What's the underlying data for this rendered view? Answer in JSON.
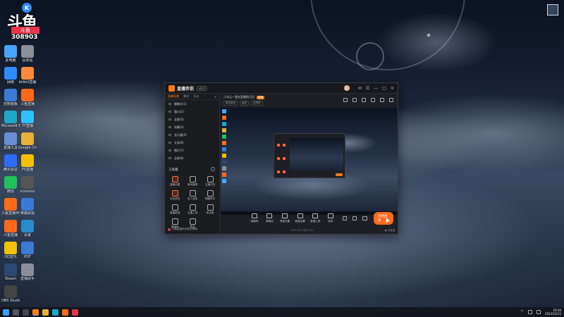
{
  "badge": {
    "k_letter": "K",
    "logo": "斗鱼",
    "tag": "斗鱼",
    "room_number": "308903"
  },
  "desktop_icons": [
    {
      "label": "此电脑",
      "color": "#4aa3ff"
    },
    {
      "label": "回收站",
      "color": "#8a8f9a"
    },
    {
      "label": "网络",
      "color": "#2f8cff"
    },
    {
      "label": "bilibili直播",
      "color": "#ff8a3a"
    },
    {
      "label": "控制面板",
      "color": "#3a7bd5"
    },
    {
      "label": "斗鱼直播",
      "color": "#ff6a1a"
    },
    {
      "label": "Microsoft Edge",
      "color": "#1fa7c9"
    },
    {
      "label": "YY直播",
      "color": "#2fc0ff"
    },
    {
      "label": "直播工具",
      "color": "#6b8fd6"
    },
    {
      "label": "Google Chrome",
      "color": "#e8b13a"
    },
    {
      "label": "腾讯会议",
      "color": "#2f6bff"
    },
    {
      "label": "PS直播",
      "color": "#f2c100"
    },
    {
      "label": "微信",
      "color": "#22c05a"
    },
    {
      "label": "ncsurion",
      "color": "#555"
    },
    {
      "label": "斗鱼直播伴侣",
      "color": "#ff6a1a"
    },
    {
      "label": "英雄联盟",
      "color": "#3a7bd5"
    },
    {
      "label": "斗鱼直播",
      "color": "#ff6a1a"
    },
    {
      "label": "设置",
      "color": "#2a8ac9"
    },
    {
      "label": "QQ音乐",
      "color": "#f2c100"
    },
    {
      "label": "PDF",
      "color": "#3a7bd5"
    },
    {
      "label": "Steam",
      "color": "#2a4a73"
    },
    {
      "label": "直播助手",
      "color": "#8a8f9a"
    },
    {
      "label": "OBS Studio",
      "color": "#444"
    }
  ],
  "app": {
    "title": "直播伴侣",
    "version": "v6.3",
    "left_tabs": [
      "直播场景",
      "素材",
      "互动"
    ],
    "scenes": [
      {
        "name": "摄像头(1)"
      },
      {
        "name": "窗口(2)"
      },
      {
        "name": "全屏(3)"
      },
      {
        "name": "场景(4)"
      },
      {
        "name": "显示器(5)"
      },
      {
        "name": "文本(6)"
      },
      {
        "name": "图片(7)"
      },
      {
        "name": "全屏(8)"
      }
    ],
    "toolbox_title": "工具箱",
    "tools": [
      {
        "label": "直播设置",
        "orange": true
      },
      {
        "label": "房间管理",
        "orange": false
      },
      {
        "label": "主播任务",
        "orange": false
      },
      {
        "label": "互动游戏",
        "orange": true
      },
      {
        "label": "多人连麦",
        "orange": false
      },
      {
        "label": "弹幕助手",
        "orange": false
      },
      {
        "label": "直播数据",
        "orange": false
      },
      {
        "label": "主播工具",
        "orange": false
      },
      {
        "label": "粉丝团",
        "orange": false
      },
      {
        "label": "直播间",
        "orange": false
      },
      {
        "label": "更多",
        "orange": false
      }
    ],
    "footer_text": "斗鱼直播伴侣使用帮助",
    "main_title": "二次元一直在直播的日记",
    "main_tag": "直播",
    "main_subtags": [
      "单机游戏",
      "画质",
      "分辨率"
    ],
    "bottom_items": [
      "直播间",
      "弹幕池",
      "视频设置",
      "直播设置",
      "直播工具",
      "连麦"
    ],
    "go_live": "开始直播",
    "status_left": "CPU 12%  内存 45%",
    "status_right": "● 未直播"
  },
  "taskbar": {
    "time": "19:30",
    "date": "2023/10/15"
  }
}
